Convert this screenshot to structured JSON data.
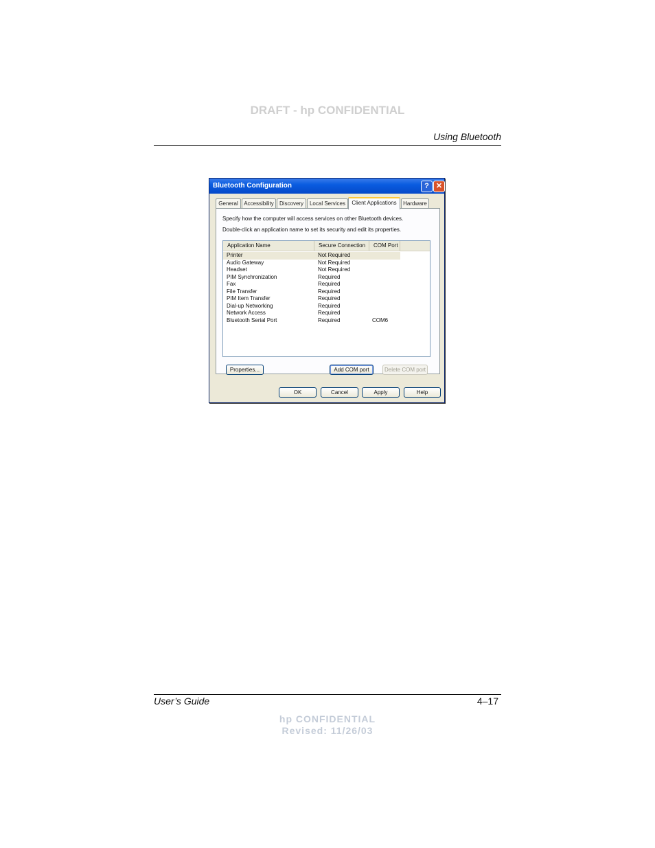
{
  "page": {
    "draft_header": "DRAFT - hp CONFIDENTIAL",
    "section_title": "Using Bluetooth",
    "footer_left": "User’s Guide",
    "footer_right": "4–17",
    "confidential_line1": "hp CONFIDENTIAL",
    "confidential_line2": "Revised: 11/26/03"
  },
  "dialog": {
    "title": "Bluetooth Configuration",
    "help_button": "?",
    "close_button": "✕",
    "tabs": [
      {
        "label": "General",
        "active": false
      },
      {
        "label": "Accessibility",
        "active": false
      },
      {
        "label": "Discovery",
        "active": false
      },
      {
        "label": "Local Services",
        "active": false
      },
      {
        "label": "Client Applications",
        "active": true
      },
      {
        "label": "Hardware",
        "active": false
      }
    ],
    "description_line1": "Specify how the computer will access services on other Bluetooth devices.",
    "description_line2": "Double-click an application name to set its security and edit its properties.",
    "columns": [
      "Application Name",
      "Secure Connection",
      "COM Port"
    ],
    "rows": [
      {
        "name": "Printer",
        "secure": "Not Required",
        "port": "",
        "selected": true
      },
      {
        "name": "Audio Gateway",
        "secure": "Not Required",
        "port": ""
      },
      {
        "name": "Headset",
        "secure": "Not Required",
        "port": ""
      },
      {
        "name": "PIM Synchronization",
        "secure": "Required",
        "port": ""
      },
      {
        "name": "Fax",
        "secure": "Required",
        "port": ""
      },
      {
        "name": "File Transfer",
        "secure": "Required",
        "port": ""
      },
      {
        "name": "PIM Item Transfer",
        "secure": "Required",
        "port": ""
      },
      {
        "name": "Dial-up Networking",
        "secure": "Required",
        "port": ""
      },
      {
        "name": "Network Access",
        "secure": "Required",
        "port": ""
      },
      {
        "name": "Bluetooth Serial Port",
        "secure": "Required",
        "port": "COM6"
      }
    ],
    "buttons": {
      "properties": "Properties...",
      "add_com": "Add COM port",
      "delete_com": "Delete COM port",
      "ok": "OK",
      "cancel": "Cancel",
      "apply": "Apply",
      "help": "Help"
    },
    "colors": {
      "titlebar": "#0a5ce0",
      "dialog_face": "#ece9d8",
      "active_tab_accent": "#ffc83c"
    }
  }
}
